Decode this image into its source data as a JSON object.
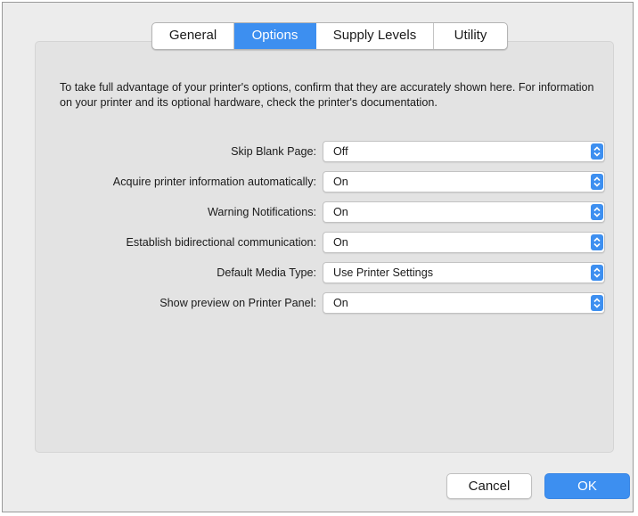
{
  "tabs": [
    {
      "label": "General",
      "selected": false
    },
    {
      "label": "Options",
      "selected": true
    },
    {
      "label": "Supply Levels",
      "selected": false
    },
    {
      "label": "Utility",
      "selected": false
    }
  ],
  "intro": "To take full advantage of your printer's options, confirm that they are accurately shown here. For information on your printer and its optional hardware, check the printer's documentation.",
  "options": [
    {
      "label": "Skip Blank Page:",
      "value": "Off"
    },
    {
      "label": "Acquire printer information automatically:",
      "value": "On"
    },
    {
      "label": "Warning Notifications:",
      "value": "On"
    },
    {
      "label": "Establish bidirectional communication:",
      "value": "On"
    },
    {
      "label": "Default Media Type:",
      "value": "Use Printer Settings"
    },
    {
      "label": "Show preview on Printer Panel:",
      "value": "On"
    }
  ],
  "buttons": {
    "cancel": "Cancel",
    "ok": "OK"
  },
  "colors": {
    "accent": "#3d8ff0",
    "window_bg": "#ececec",
    "panel_bg": "#e3e3e3"
  },
  "icons": {
    "select_stepper": "chevron-up-down-icon"
  }
}
